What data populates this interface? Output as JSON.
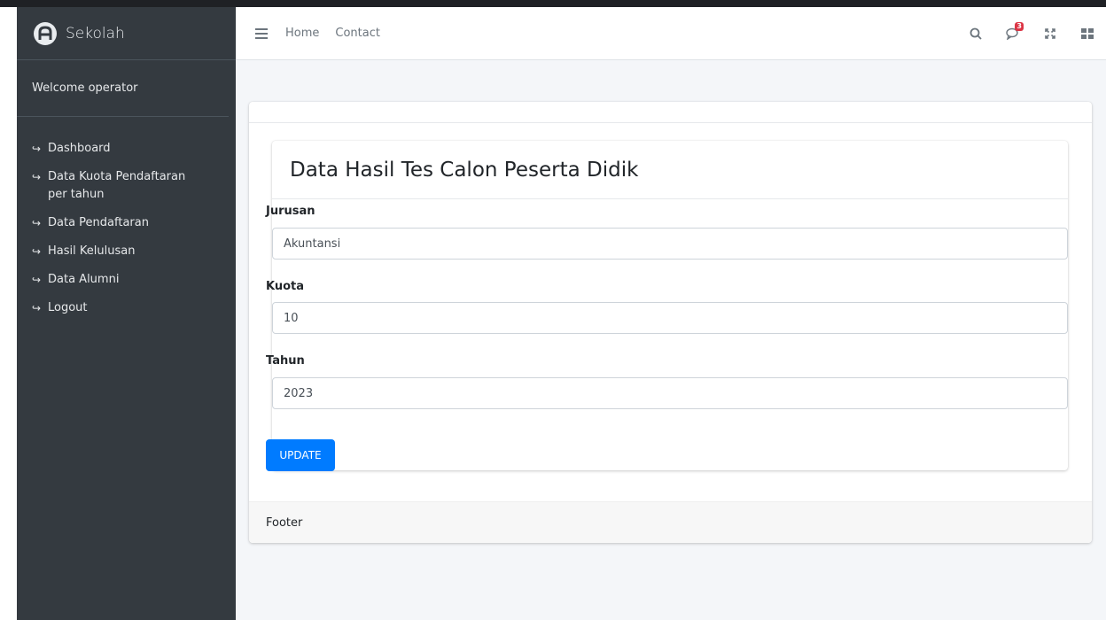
{
  "brand": {
    "name": "Sekolah",
    "logo_icon": "adminlte-logo-icon"
  },
  "sidebar": {
    "welcome": "Welcome operator",
    "items": [
      {
        "label": "Dashboard",
        "icon": "sign-out-icon"
      },
      {
        "label": "Data Kuota Pendaftaran per tahun",
        "icon": "sign-out-icon"
      },
      {
        "label": "Data Pendaftaran",
        "icon": "sign-out-icon"
      },
      {
        "label": "Hasil Kelulusan",
        "icon": "sign-out-icon"
      },
      {
        "label": "Data Alumni",
        "icon": "sign-out-icon"
      },
      {
        "label": "Logout",
        "icon": "sign-out-icon"
      }
    ]
  },
  "navbar": {
    "links": [
      "Home",
      "Contact"
    ],
    "notification_count": "3"
  },
  "main": {
    "title": "Data Hasil Tes Calon Peserta Didik",
    "fields": [
      {
        "label": "Jurusan",
        "value": "Akuntansi"
      },
      {
        "label": "Kuota",
        "value": "10"
      },
      {
        "label": "Tahun",
        "value": "2023"
      }
    ],
    "submit_label": "UPDATE",
    "footer": "Footer"
  },
  "colors": {
    "sidebar_bg": "#343a40",
    "primary": "#007bff",
    "badge": "#dc3545",
    "content_bg": "#f4f6f9"
  }
}
